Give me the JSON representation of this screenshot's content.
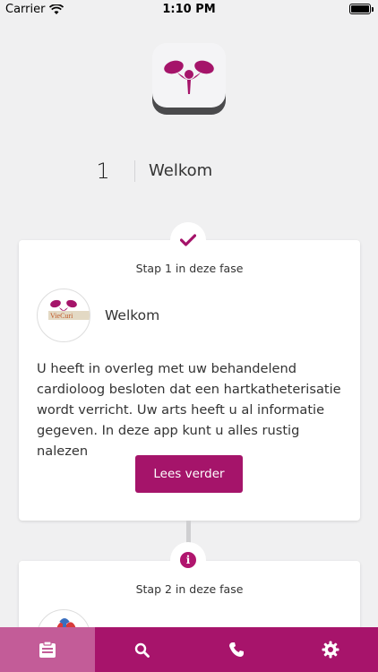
{
  "status_bar": {
    "carrier": "Carrier",
    "time": "1:10 PM"
  },
  "colors": {
    "brand": "#a5146a",
    "nav_active": "#c35c98",
    "background": "#f0f0f1"
  },
  "phase": {
    "number": "1",
    "title": "Welkom"
  },
  "steps": [
    {
      "label": "Stap 1 in deze fase",
      "status_icon": "check-icon",
      "title": "Welkom",
      "avatar_text": "VieCuri",
      "body": "U heeft in overleg met uw behandelend cardioloog besloten dat een hartkatheterisatie wordt verricht. Uw arts heeft u al informatie gegeven. In deze app kunt u alles rustig nalezen",
      "button_label": "Lees verder"
    },
    {
      "label": "Stap 2 in deze fase",
      "status_icon": "info-icon"
    }
  ],
  "bottom_nav": [
    {
      "icon": "clipboard-icon",
      "active": true
    },
    {
      "icon": "search-icon",
      "active": false
    },
    {
      "icon": "phone-icon",
      "active": false
    },
    {
      "icon": "gear-icon",
      "active": false
    }
  ]
}
